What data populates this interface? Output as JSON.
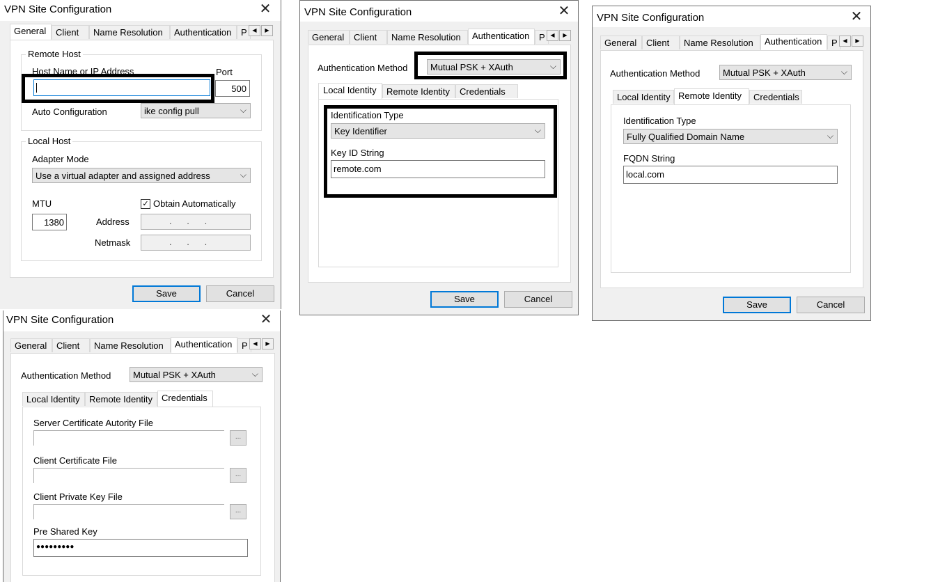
{
  "common": {
    "window_title": "VPN Site Configuration",
    "close_glyph": "✕",
    "tabs": [
      "General",
      "Client",
      "Name Resolution",
      "Authentication",
      "P"
    ],
    "arrow_left": "◀",
    "arrow_right": "▶",
    "combo_chevron": "⌵",
    "save_label": "Save",
    "cancel_label": "Cancel",
    "auth_method_label": "Authentication Method",
    "auth_method_value": "Mutual PSK + XAuth",
    "subtabs": [
      "Local Identity",
      "Remote Identity",
      "Credentials"
    ],
    "identification_type_label": "Identification Type",
    "icons": {
      "close": "close-icon",
      "tab_scroll_left": "arrow-left-icon",
      "tab_scroll_right": "arrow-right-icon",
      "dropdown": "chevron-down-icon",
      "checkbox": "checkmark-icon"
    }
  },
  "general": {
    "remote_host_group": "Remote Host",
    "host_label": "Host Name or IP Address",
    "host_value": "",
    "port_label": "Port",
    "port_value": "500",
    "auto_config_label": "Auto Configuration",
    "auto_config_value": "ike config pull",
    "local_host_group": "Local Host",
    "adapter_mode_label": "Adapter Mode",
    "adapter_mode_value": "Use a virtual adapter and assigned address",
    "mtu_label": "MTU",
    "mtu_value": "1380",
    "obtain_auto_label": "Obtain Automatically",
    "obtain_auto_checked": true,
    "address_label": "Address",
    "netmask_label": "Netmask",
    "ip_dots": ".      .      ."
  },
  "local_identity": {
    "id_type_value": "Key Identifier",
    "key_id_label": "Key ID String",
    "key_id_value": "remote.com"
  },
  "remote_identity": {
    "id_type_value": "Fully Qualified Domain Name",
    "fqdn_label": "FQDN String",
    "fqdn_value": "local.com"
  },
  "credentials": {
    "server_ca_label": "Server Certificate Autority File",
    "client_cert_label": "Client Certificate File",
    "client_key_label": "Client Private Key File",
    "browse_glyph": "...",
    "psk_label": "Pre Shared Key",
    "psk_value": "●●●●●●●●●"
  }
}
